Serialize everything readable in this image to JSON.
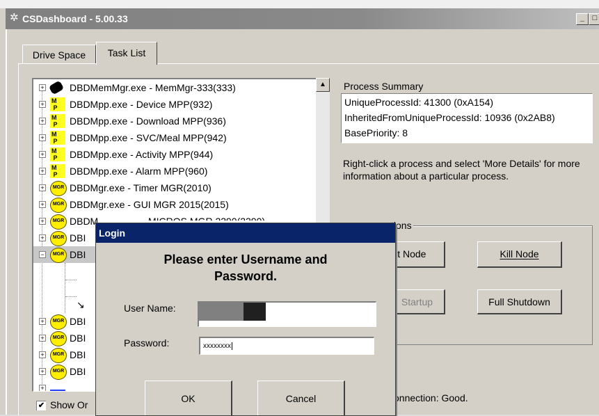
{
  "window": {
    "title": "CSDashboard - 5.00.33",
    "icon": "app-icon",
    "controls": [
      "minimize",
      "maximize"
    ]
  },
  "tabs": [
    {
      "label": "Drive Space",
      "active": false
    },
    {
      "label": "Task List",
      "active": true
    }
  ],
  "tree": {
    "items": [
      {
        "label": "DBDMemMgr.exe - MemMgr-333(333)",
        "icon": "memmgr-icon"
      },
      {
        "label": "DBDMpp.exe - Device MPP(932)",
        "icon": "mpp-icon"
      },
      {
        "label": "DBDMpp.exe - Download MPP(936)",
        "icon": "mpp-icon"
      },
      {
        "label": "DBDMpp.exe - SVC/Meal MPP(942)",
        "icon": "mpp-icon"
      },
      {
        "label": "DBDMpp.exe - Activity MPP(944)",
        "icon": "mpp-icon"
      },
      {
        "label": "DBDMpp.exe - Alarm MPP(960)",
        "icon": "mpp-icon"
      },
      {
        "label": "DBDMgr.exe - Timer MGR(2010)",
        "icon": "mgr-icon"
      },
      {
        "label": "DBDMgr.exe - GUI MGR 2015(2015)",
        "icon": "mgr-icon"
      },
      {
        "label": "DBDM",
        "icon": "mgr-icon"
      },
      {
        "label": "DBI",
        "icon": "mgr-icon"
      },
      {
        "label": "DBI",
        "icon": "mgr-icon"
      },
      {
        "label": "DBI",
        "icon": "mgr-icon"
      },
      {
        "label": "DBI",
        "icon": "mgr-icon"
      },
      {
        "label": "DBI",
        "icon": "mgr-icon"
      },
      {
        "label": "DBI",
        "icon": "mgr-icon"
      }
    ],
    "partial_text": "MICROS MGR 2290(2290)"
  },
  "process_summary": {
    "label": "Process Summary",
    "lines": [
      "UniqueProcessId: 41300 (0xA154)",
      "InheritedFromUniqueProcessId: 10936 (0x2AB8)",
      "BasePriority: 8"
    ]
  },
  "hint": "Right-click a process and select 'More Details' for more information about a particular process.",
  "actions": {
    "group_label": "tions",
    "start_node": "rt Node",
    "kill_node": "Kill Node",
    "startup": "Startup",
    "full_shutdown": "Full Shutdown"
  },
  "connection": "onnection: Good.",
  "show_option": {
    "label": "Show Or",
    "checked": true
  },
  "login_dialog": {
    "title": "Login",
    "heading_line1": "Please enter Username and",
    "heading_line2": "Password.",
    "username_label": "User Name:",
    "password_label": "Password:",
    "password_value": "xxxxxxxx",
    "ok": "OK",
    "cancel": "Cancel"
  },
  "colors": {
    "dialog_title_bg": "#0a246a",
    "window_bg": "#d4d0c8",
    "mpp_icon": "#ffff20",
    "mgr_icon": "#ffee00"
  }
}
